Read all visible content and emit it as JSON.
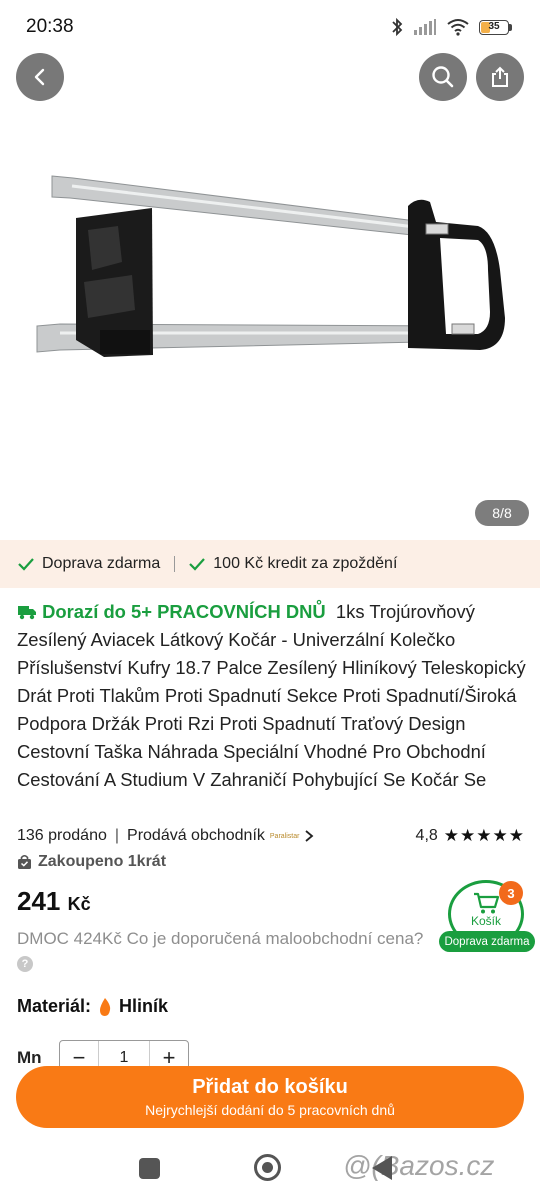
{
  "status_bar": {
    "time": "20:38",
    "battery": "35"
  },
  "gallery": {
    "counter": "8/8"
  },
  "benefits": [
    {
      "label": "Doprava zdarma"
    },
    {
      "label": "100 Kč kredit za zpoždění"
    }
  ],
  "product": {
    "delivery_tag": "Dorazí do 5+ PRACOVNÍCH DNŮ",
    "title": "1ks Trojúrovňový Zesílený Aviacek Látkový Kočár - Univerzální Kolečko Příslušenství Kufry 18.7 Palce Zesílený Hliníkový Teleskopický Drát Proti Tlakům Proti Spadnutí Sekce Proti Spadnutí/Široká Podpora Držák Proti Rzi Proti Spadnutí Traťový Design Cestovní Taška Náhrada Speciální Vhodné Pro Obchodní Cestování A Studium V Zahraničí Pohybující Se Kočár Se",
    "sold": "136 prodáno",
    "seller_label": "Prodává obchodník",
    "seller_logo_text": "Paralistar",
    "rating": "4,8",
    "rating_stars": 4.8,
    "stars": "★★★★★",
    "purchased": "Zakoupeno 1krát",
    "price": "241",
    "currency": "Kč",
    "rrp_text": "DMOC 424Kč Co je doporučená maloobchodní cena?",
    "help": "?",
    "material_label": "Materiál:",
    "material_value": "Hliník",
    "qty_label": "Mn",
    "qty_value": "1",
    "qty_minus": "−",
    "qty_plus": "+"
  },
  "cart": {
    "count": "3",
    "label": "Košík",
    "ribbon": "Doprava zdarma"
  },
  "cta": {
    "main": "Přidat do košíku",
    "sub": "Nejrychlejší dodání do 5 pracovních dnů"
  },
  "watermark": "@(Bazos.cz",
  "colors": {
    "accent": "#f97a15",
    "green": "#1a9e3f",
    "benefit_bg": "#fcefe6",
    "badge": "#f26a1b"
  }
}
